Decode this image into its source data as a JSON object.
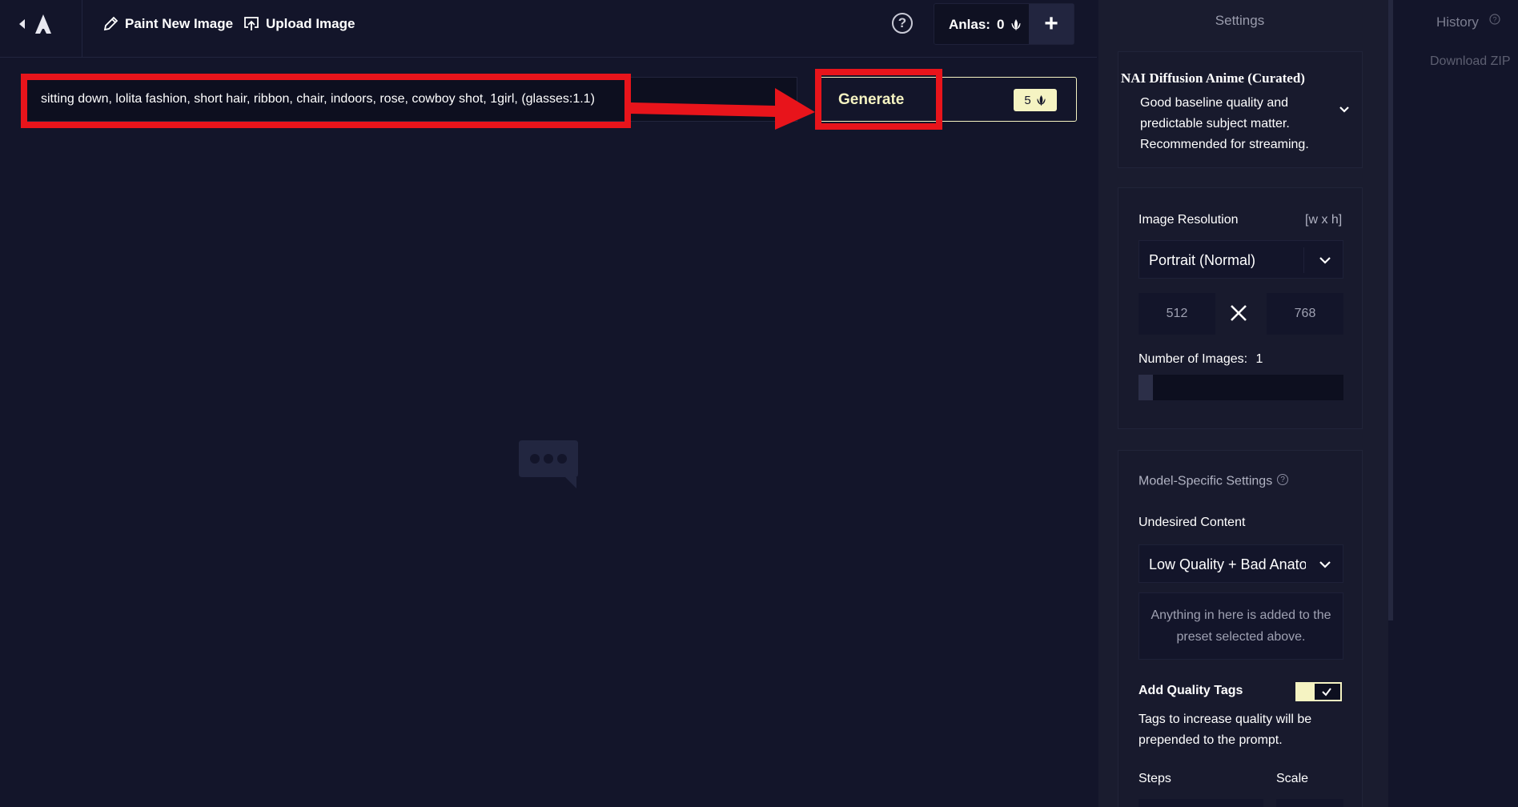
{
  "topbar": {
    "paint_label": "Paint New Image",
    "upload_label": "Upload Image",
    "help_label": "?",
    "anlas_label": "Anlas:",
    "anlas_value": "0",
    "add_label": "+"
  },
  "prompt": {
    "value": "sitting down, lolita fashion, short hair, ribbon, chair, indoors, rose, cowboy shot, 1girl, (glasses:1.1)"
  },
  "generate": {
    "label": "Generate",
    "cost": "5"
  },
  "settings": {
    "title": "Settings",
    "model": {
      "name": "NAI Diffusion Anime (Curated)",
      "description": "Good baseline quality and predictable subject matter. Recommended for streaming."
    },
    "resolution": {
      "label": "Image Resolution",
      "hint": "[w x h]",
      "preset": "Portrait (Normal)",
      "width": "512",
      "height": "768"
    },
    "num_images": {
      "label": "Number of Images:",
      "value": "1"
    },
    "model_specific": {
      "label": "Model-Specific Settings",
      "undesired_label": "Undesired Content",
      "undesired_preset": "Low Quality + Bad Anatomy",
      "undesired_placeholder": "Anything in here is added to the preset selected above.",
      "quality_tags_label": "Add Quality Tags",
      "quality_tags_desc": "Tags to increase quality will be prepended to the prompt.",
      "quality_tags_on": true,
      "steps_label": "Steps",
      "scale_label": "Scale"
    }
  },
  "history": {
    "title": "History",
    "download_label": "Download ZIP"
  },
  "colors": {
    "background": "#13152a",
    "accent": "#f5f3c2",
    "highlight": "#e8141b"
  }
}
